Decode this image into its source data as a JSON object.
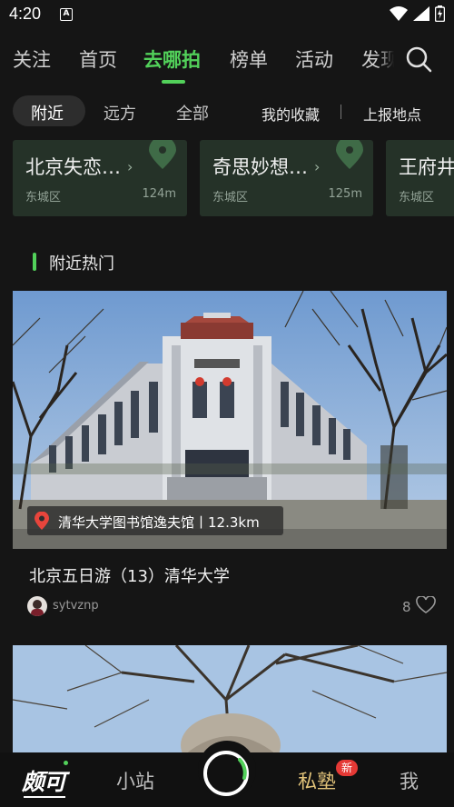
{
  "status_bar": {
    "time": "4:20",
    "notification_icon": "A"
  },
  "top_tabs": [
    {
      "label": "关注"
    },
    {
      "label": "首页"
    },
    {
      "label": "去哪拍",
      "active": true
    },
    {
      "label": "榜单"
    },
    {
      "label": "活动"
    },
    {
      "label": "发现"
    }
  ],
  "sub_tabs": [
    {
      "label": "附近",
      "active": true
    },
    {
      "label": "远方"
    },
    {
      "label": "全部"
    }
  ],
  "sub_links": {
    "favorites": "我的收藏",
    "report": "上报地点"
  },
  "places": [
    {
      "title": "北京失恋…",
      "district": "东城区",
      "distance": "124m"
    },
    {
      "title": "奇思妙想…",
      "district": "东城区",
      "distance": "125m"
    },
    {
      "title": "王府井",
      "district": "东城区",
      "distance": ""
    }
  ],
  "section": {
    "title": "附近热门"
  },
  "post": {
    "location": "清华大学图书馆逸夫馆丨12.3km",
    "title": "北京五日游（13）清华大学",
    "author": "sytvznp",
    "likes": "8"
  },
  "bottom_nav": {
    "logo": "颇可",
    "station": "小站",
    "private": "私塾",
    "private_badge": "新",
    "me": "我"
  },
  "colors": {
    "accent": "#52d15a",
    "card_bg": "#253228",
    "badge": "#e53935",
    "gold": "#e3c47a"
  }
}
